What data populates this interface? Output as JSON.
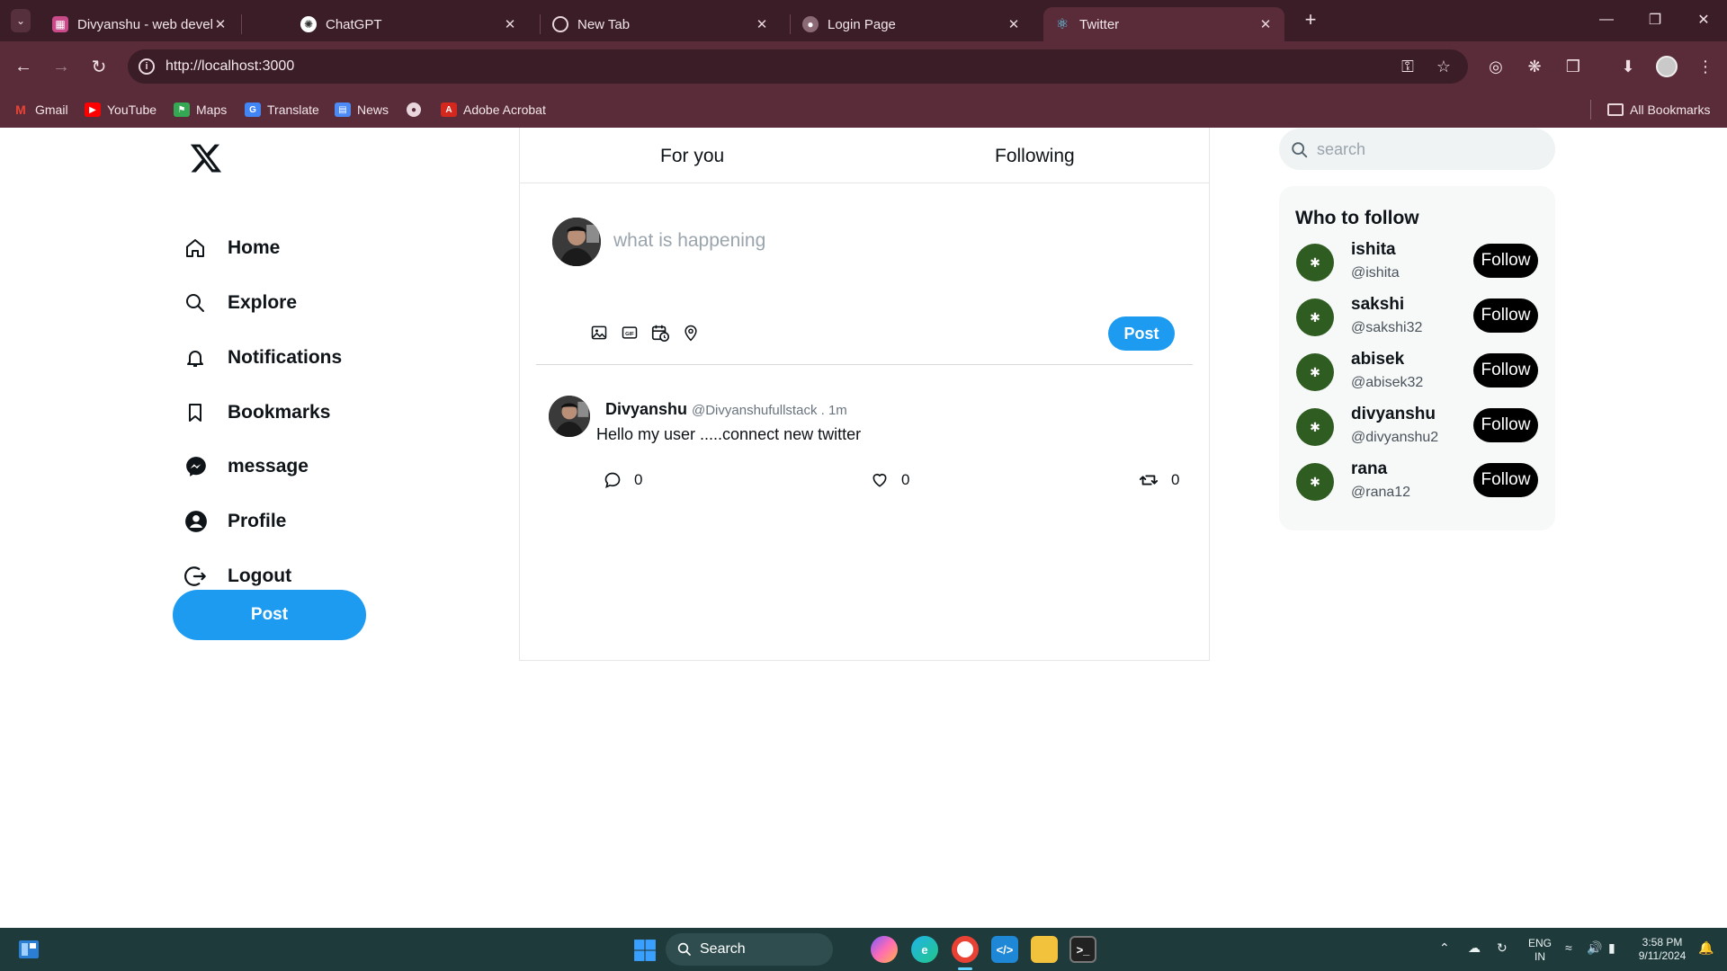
{
  "browser": {
    "tabs": [
      {
        "title": "Divyanshu - web developer",
        "active": false
      },
      {
        "title": "ChatGPT",
        "active": false
      },
      {
        "title": "New Tab",
        "active": false
      },
      {
        "title": "Login Page",
        "active": false
      },
      {
        "title": "Twitter",
        "active": true
      }
    ],
    "url": "http://localhost:3000",
    "bookmarks": [
      "Gmail",
      "YouTube",
      "Maps",
      "Translate",
      "News",
      "Adobe Acrobat"
    ],
    "all_bookmarks_label": "All Bookmarks"
  },
  "sidebar": {
    "nav": [
      {
        "label": "Home",
        "icon": "home-icon"
      },
      {
        "label": "Explore",
        "icon": "search-icon"
      },
      {
        "label": "Notifications",
        "icon": "bell-icon"
      },
      {
        "label": "Bookmarks",
        "icon": "bookmark-icon"
      },
      {
        "label": "message",
        "icon": "messenger-icon"
      },
      {
        "label": "Profile",
        "icon": "user-circle-icon"
      },
      {
        "label": "Logout",
        "icon": "logout-icon"
      }
    ],
    "post_label": "Post"
  },
  "feed": {
    "tabs": [
      "For you",
      "Following"
    ],
    "composer": {
      "placeholder": "what is happening",
      "post_label": "Post"
    },
    "tweets": [
      {
        "name": "Divyanshu",
        "handle": "@Divyanshufullstack . 1m",
        "text": "Hello my user .....connect new twitter",
        "replies": "0",
        "likes": "0",
        "retweets": "0"
      }
    ]
  },
  "right": {
    "search_placeholder": "search",
    "who_to_follow_title": "Who to follow",
    "follow_label": "Follow",
    "users": [
      {
        "name": "ishita",
        "handle": "@ishita"
      },
      {
        "name": "sakshi",
        "handle": "@sakshi32"
      },
      {
        "name": "abisek",
        "handle": "@abisek32"
      },
      {
        "name": "divyanshu",
        "handle": "@divyanshu2"
      },
      {
        "name": "rana",
        "handle": "@rana12"
      }
    ]
  },
  "taskbar": {
    "search_label": "Search",
    "lang_line1": "ENG",
    "lang_line2": "IN",
    "time": "3:58 PM",
    "date": "9/11/2024"
  },
  "colors": {
    "accent": "#1d9bf0",
    "chrome": "#5a2c3a",
    "tabbar": "#3a1d27",
    "taskbar": "#1f3a3b"
  }
}
